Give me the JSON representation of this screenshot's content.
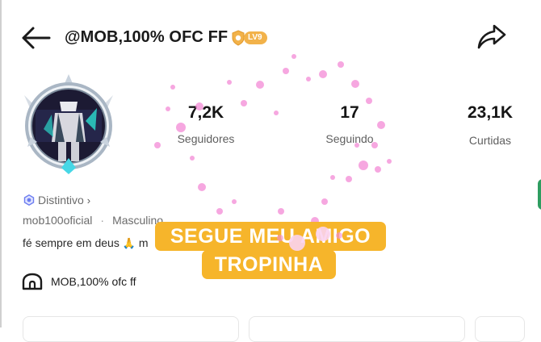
{
  "header": {
    "title": "@MOB,100% OFC FF",
    "level_badge": "LV9"
  },
  "stats": {
    "followers": {
      "value": "7,2K",
      "label": "Seguidores"
    },
    "following": {
      "value": "17",
      "label": "Seguindo"
    },
    "likes": {
      "value": "23,1K",
      "label": "Curtidas"
    }
  },
  "profile": {
    "badge_label": "Distintivo",
    "username": "mob100oficial",
    "gender": "Masculino",
    "bio": "fé sempre em deus",
    "bio_trail": "m",
    "community": "MOB,100% ofc ff"
  },
  "overlay": {
    "line1": "SEGUE MEU AMIGO",
    "line2": "TROPINHA"
  },
  "colors": {
    "accent_orange": "#f6b52b",
    "level_badge": "#f2b24a",
    "badge_icon": "#6b7cf0",
    "sparkle_pink": "#f48ad6",
    "side_tab": "#2e9d60"
  }
}
